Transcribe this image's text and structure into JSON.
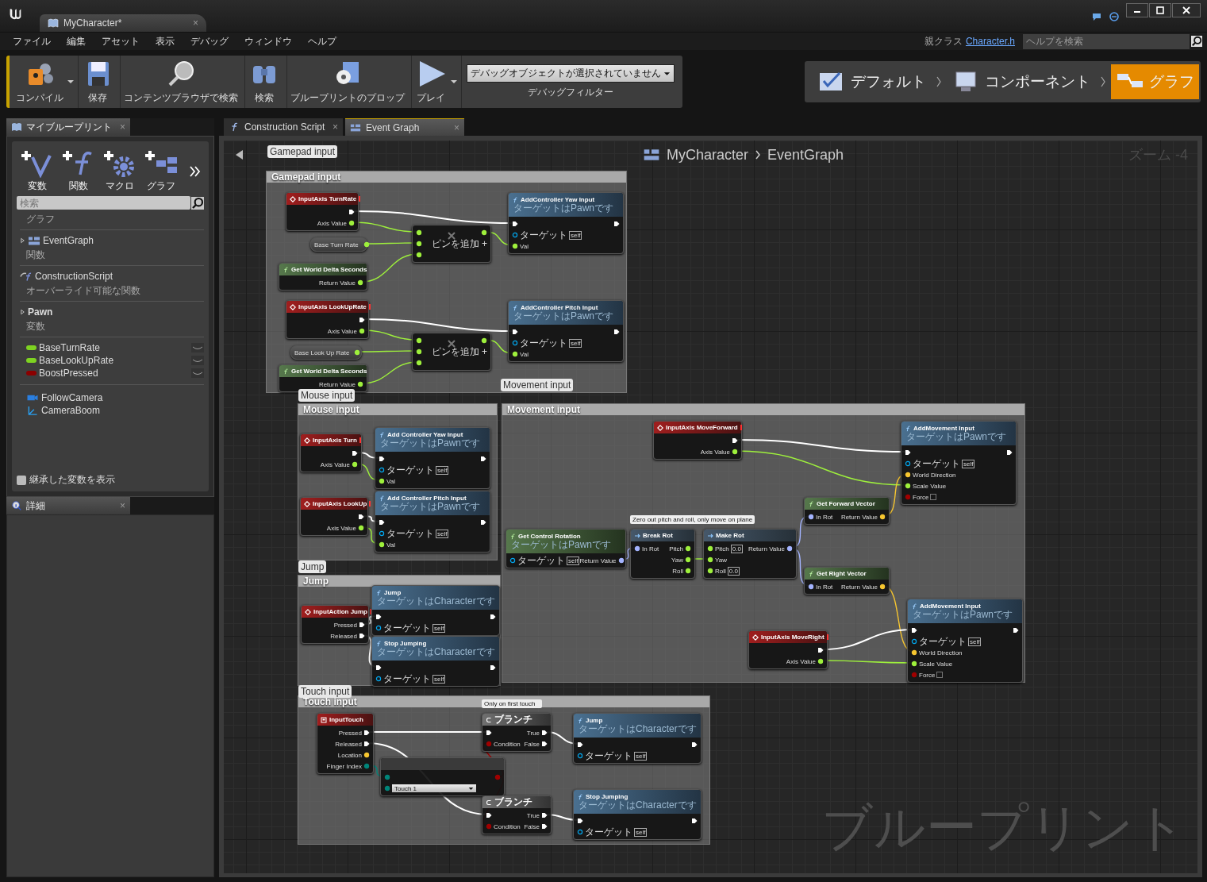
{
  "window": {
    "tab": "MyCharacter*",
    "close": "×"
  },
  "menu": [
    "ファイル",
    "編集",
    "アセット",
    "表示",
    "デバッグ",
    "ウィンドウ",
    "ヘルプ"
  ],
  "parent_class": {
    "label": "親クラス",
    "link": "Character.h"
  },
  "help_search": {
    "placeholder": "ヘルプを検索"
  },
  "toolbar": [
    {
      "kind": "compile",
      "label": "コンパイル",
      "dropdown": true
    },
    {
      "kind": "save",
      "label": "保存",
      "dropdown": false
    },
    {
      "kind": "browse",
      "label": "コンテンツブラウザで検索",
      "dropdown": false
    },
    {
      "kind": "find",
      "label": "検索",
      "dropdown": false
    },
    {
      "kind": "props",
      "label": "ブループリントのプロップ",
      "dropdown": false
    },
    {
      "kind": "play",
      "label": "プレイ",
      "dropdown": true
    }
  ],
  "debug": {
    "value": "デバッグオブジェクトが選択されていません",
    "caption": "デバッグフィルター"
  },
  "modes": [
    {
      "kind": "defaults",
      "label": "デフォルト",
      "selected": false
    },
    {
      "kind": "components",
      "label": "コンポーネント",
      "selected": false
    },
    {
      "kind": "graph",
      "label": "グラフ",
      "selected": true
    }
  ],
  "my_blueprint": {
    "tab": "マイブループリント",
    "close": "×",
    "add_buttons": [
      {
        "kind": "variable",
        "label": "変数"
      },
      {
        "kind": "function",
        "label": "関数"
      },
      {
        "kind": "macro",
        "label": "マクロ"
      },
      {
        "kind": "graph",
        "label": "グラフ"
      }
    ],
    "search": {
      "placeholder": "検索"
    },
    "entries": [
      {
        "kind": "category",
        "label": "グラフ"
      },
      {
        "kind": "graph",
        "label": "EventGraph",
        "expanded": false
      },
      {
        "kind": "category",
        "label": "関数"
      },
      {
        "kind": "function",
        "label": "ConstructionScript"
      },
      {
        "kind": "category",
        "label": "オーバーライド可能な関数"
      },
      {
        "kind": "group",
        "label": "Pawn",
        "expanded": false
      },
      {
        "kind": "category",
        "label": "変数"
      },
      {
        "kind": "variable",
        "label": "BaseTurnRate",
        "color": "#7ed321"
      },
      {
        "kind": "variable",
        "label": "BaseLookUpRate",
        "color": "#7ed321"
      },
      {
        "kind": "variable",
        "label": "BoostPressed",
        "color": "#8b0000"
      },
      {
        "kind": "camera",
        "label": "FollowCamera"
      },
      {
        "kind": "boom",
        "label": "CameraBoom"
      }
    ],
    "show_inherited": {
      "label": "継承した変数を表示",
      "checked": false
    }
  },
  "details": {
    "tab": "詳細",
    "close": "×"
  },
  "graph_tabs": [
    {
      "kind": "function",
      "label": "Construction Script",
      "selected": false,
      "close": "×"
    },
    {
      "kind": "graph",
      "label": "Event Graph",
      "selected": true,
      "close": "×"
    }
  ],
  "graph": {
    "breadcrumb": [
      "MyCharacter",
      "EventGraph"
    ],
    "zoom": "ズーム -4",
    "watermark": "ブループリント",
    "comments": [
      {
        "title": "Gamepad input",
        "bubble": "Gamepad input"
      },
      {
        "title": "Mouse input",
        "bubble": "Mouse input"
      },
      {
        "title": "Jump",
        "bubble": "Jump"
      },
      {
        "title": "Movement input",
        "bubble": "Movement input"
      },
      {
        "title": "Touch input",
        "bubble": "Touch input"
      }
    ],
    "nodes": [
      {
        "kind": "event",
        "title": "InputAxis TurnRate",
        "outputs": [
          {
            "kind": "exec"
          },
          {
            "kind": "float",
            "label": "Axis Value"
          }
        ]
      },
      {
        "kind": "variable",
        "title": "Base Turn Rate",
        "outputs": [
          {
            "kind": "float"
          }
        ]
      },
      {
        "kind": "pure",
        "title": "Get World Delta Seconds",
        "outputs": [
          {
            "kind": "float",
            "label": "Return Value"
          }
        ]
      },
      {
        "kind": "math",
        "inputs": [
          {
            "kind": "float"
          },
          {
            "kind": "float"
          },
          {
            "kind": "float"
          }
        ],
        "outputs": [
          {
            "kind": "float"
          },
          {
            "kind": "add",
            "label": "ピンを追加 +"
          }
        ]
      },
      {
        "kind": "function",
        "title": "AddController Yaw Input",
        "subtitle": "ターゲットはPawnです",
        "inputs": [
          {
            "kind": "exec"
          },
          {
            "kind": "object",
            "label": "ターゲット",
            "default": "self"
          },
          {
            "kind": "float",
            "label": "Val"
          }
        ],
        "outputs": [
          {
            "kind": "exec"
          }
        ]
      },
      {
        "kind": "event",
        "title": "InputAxis LookUpRate",
        "outputs": [
          {
            "kind": "exec"
          },
          {
            "kind": "float",
            "label": "Axis Value"
          }
        ]
      },
      {
        "kind": "variable",
        "title": "Base Look Up Rate",
        "outputs": [
          {
            "kind": "float"
          }
        ]
      },
      {
        "kind": "pure",
        "title": "Get World Delta Seconds",
        "outputs": [
          {
            "kind": "float",
            "label": "Return Value"
          }
        ]
      },
      {
        "kind": "math",
        "inputs": [
          {
            "kind": "float"
          },
          {
            "kind": "float"
          },
          {
            "kind": "float"
          }
        ],
        "outputs": [
          {
            "kind": "float"
          },
          {
            "kind": "add",
            "label": "ピンを追加 +"
          }
        ]
      },
      {
        "kind": "function",
        "title": "AddController Pitch Input",
        "subtitle": "ターゲットはPawnです",
        "inputs": [
          {
            "kind": "exec"
          },
          {
            "kind": "object",
            "label": "ターゲット",
            "default": "self"
          },
          {
            "kind": "float",
            "label": "Val"
          }
        ],
        "outputs": [
          {
            "kind": "exec"
          }
        ]
      },
      {
        "kind": "event",
        "title": "InputAxis Turn",
        "outputs": [
          {
            "kind": "exec"
          },
          {
            "kind": "float",
            "label": "Axis Value"
          }
        ]
      },
      {
        "kind": "function",
        "title": "Add Controller Yaw Input",
        "subtitle": "ターゲットはPawnです",
        "inputs": [
          {
            "kind": "exec"
          },
          {
            "kind": "object",
            "label": "ターゲット",
            "default": "self"
          },
          {
            "kind": "float",
            "label": "Val"
          }
        ],
        "outputs": [
          {
            "kind": "exec"
          }
        ]
      },
      {
        "kind": "event",
        "title": "InputAxis LookUp",
        "outputs": [
          {
            "kind": "exec"
          },
          {
            "kind": "float",
            "label": "Axis Value"
          }
        ]
      },
      {
        "kind": "function",
        "title": "Add Controller Pitch Input",
        "subtitle": "ターゲットはPawnです",
        "inputs": [
          {
            "kind": "exec"
          },
          {
            "kind": "object",
            "label": "ターゲット",
            "default": "self"
          },
          {
            "kind": "float",
            "label": "Val"
          }
        ],
        "outputs": [
          {
            "kind": "exec"
          }
        ]
      },
      {
        "kind": "event",
        "title": "InputAction Jump",
        "outputs": [
          {
            "kind": "exec",
            "label": "Pressed"
          },
          {
            "kind": "exec",
            "label": "Released"
          }
        ]
      },
      {
        "kind": "function",
        "title": "Jump",
        "subtitle": "ターゲットはCharacterです",
        "inputs": [
          {
            "kind": "exec"
          },
          {
            "kind": "object",
            "label": "ターゲット",
            "default": "self"
          }
        ],
        "outputs": [
          {
            "kind": "exec"
          }
        ]
      },
      {
        "kind": "function",
        "title": "Stop Jumping",
        "subtitle": "ターゲットはCharacterです",
        "inputs": [
          {
            "kind": "exec"
          },
          {
            "kind": "object",
            "label": "ターゲット",
            "default": "self"
          }
        ],
        "outputs": [
          {
            "kind": "exec"
          }
        ]
      },
      {
        "kind": "pure",
        "title": "Get Control Rotation",
        "subtitle": "ターゲットはPawnです",
        "inputs": [
          {
            "kind": "object",
            "label": "ターゲット",
            "default": "self"
          }
        ],
        "outputs": [
          {
            "kind": "rotator",
            "label": "Return Value"
          }
        ]
      },
      {
        "kind": "event",
        "title": "InputAxis MoveForward",
        "outputs": [
          {
            "kind": "exec"
          },
          {
            "kind": "float",
            "label": "Axis Value"
          }
        ]
      },
      {
        "kind": "struct",
        "title": "Break Rot",
        "comment": "Zero out pitch and roll, only move on plane",
        "inputs": [
          {
            "kind": "rotator",
            "label": "In Rot"
          }
        ],
        "outputs": [
          {
            "kind": "float",
            "label": "Pitch"
          },
          {
            "kind": "float",
            "label": "Yaw"
          },
          {
            "kind": "float",
            "label": "Roll"
          }
        ]
      },
      {
        "kind": "struct",
        "title": "Make Rot",
        "inputs": [
          {
            "kind": "float",
            "label": "Pitch",
            "default": "0.0"
          },
          {
            "kind": "float",
            "label": "Yaw"
          },
          {
            "kind": "float",
            "label": "Roll",
            "default": "0.0"
          }
        ],
        "outputs": [
          {
            "kind": "rotator",
            "label": "Return Value"
          }
        ]
      },
      {
        "kind": "pure",
        "title": "Get Forward Vector",
        "inputs": [
          {
            "kind": "rotator",
            "label": "In Rot"
          }
        ],
        "outputs": [
          {
            "kind": "vector",
            "label": "Return Value"
          }
        ]
      },
      {
        "kind": "pure",
        "title": "Get Right Vector",
        "inputs": [
          {
            "kind": "rotator",
            "label": "In Rot"
          }
        ],
        "outputs": [
          {
            "kind": "vector",
            "label": "Return Value"
          }
        ]
      },
      {
        "kind": "event",
        "title": "InputAxis MoveRight",
        "outputs": [
          {
            "kind": "exec"
          },
          {
            "kind": "float",
            "label": "Axis Value"
          }
        ]
      },
      {
        "kind": "function",
        "title": "AddMovement Input",
        "subtitle": "ターゲットはPawnです",
        "inputs": [
          {
            "kind": "exec"
          },
          {
            "kind": "object",
            "label": "ターゲット",
            "default": "self"
          },
          {
            "kind": "vector",
            "label": "World Direction"
          },
          {
            "kind": "float",
            "label": "Scale Value"
          },
          {
            "kind": "bool",
            "label": "Force",
            "checked": false
          }
        ],
        "outputs": [
          {
            "kind": "exec"
          }
        ]
      },
      {
        "kind": "function",
        "title": "AddMovement Input",
        "subtitle": "ターゲットはPawnです",
        "inputs": [
          {
            "kind": "exec"
          },
          {
            "kind": "object",
            "label": "ターゲット",
            "default": "self"
          },
          {
            "kind": "vector",
            "label": "World Direction"
          },
          {
            "kind": "float",
            "label": "Scale Value"
          },
          {
            "kind": "bool",
            "label": "Force",
            "checked": false
          }
        ],
        "outputs": [
          {
            "kind": "exec"
          }
        ]
      },
      {
        "kind": "touch",
        "title": "InputTouch",
        "outputs": [
          {
            "kind": "exec",
            "label": "Pressed"
          },
          {
            "kind": "exec",
            "label": "Released"
          },
          {
            "kind": "vector",
            "label": "Location"
          },
          {
            "kind": "byte",
            "label": "Finger Index"
          }
        ]
      },
      {
        "kind": "branch",
        "title": "ブランチ",
        "comment": "Only on first touch",
        "inputs": [
          {
            "kind": "exec"
          },
          {
            "kind": "bool",
            "label": "Condition"
          }
        ],
        "outputs": [
          {
            "kind": "exec",
            "label": "True"
          },
          {
            "kind": "exec",
            "label": "False"
          }
        ]
      },
      {
        "kind": "compare",
        "inputs": [
          {
            "kind": "byte"
          },
          {
            "kind": "byte",
            "dropdown": "Touch 1"
          }
        ],
        "outputs": [
          {
            "kind": "bool"
          }
        ]
      },
      {
        "kind": "branch",
        "title": "ブランチ",
        "inputs": [
          {
            "kind": "exec"
          },
          {
            "kind": "bool",
            "label": "Condition"
          }
        ],
        "outputs": [
          {
            "kind": "exec",
            "label": "True"
          },
          {
            "kind": "exec",
            "label": "False"
          }
        ]
      },
      {
        "kind": "function",
        "title": "Jump",
        "subtitle": "ターゲットはCharacterです",
        "inputs": [
          {
            "kind": "exec"
          },
          {
            "kind": "object",
            "label": "ターゲット",
            "default": "self"
          }
        ],
        "outputs": [
          {
            "kind": "exec"
          }
        ]
      },
      {
        "kind": "function",
        "title": "Stop Jumping",
        "subtitle": "ターゲットはCharacterです",
        "inputs": [
          {
            "kind": "exec"
          },
          {
            "kind": "object",
            "label": "ターゲット",
            "default": "self"
          }
        ],
        "outputs": [
          {
            "kind": "exec"
          }
        ]
      }
    ]
  }
}
